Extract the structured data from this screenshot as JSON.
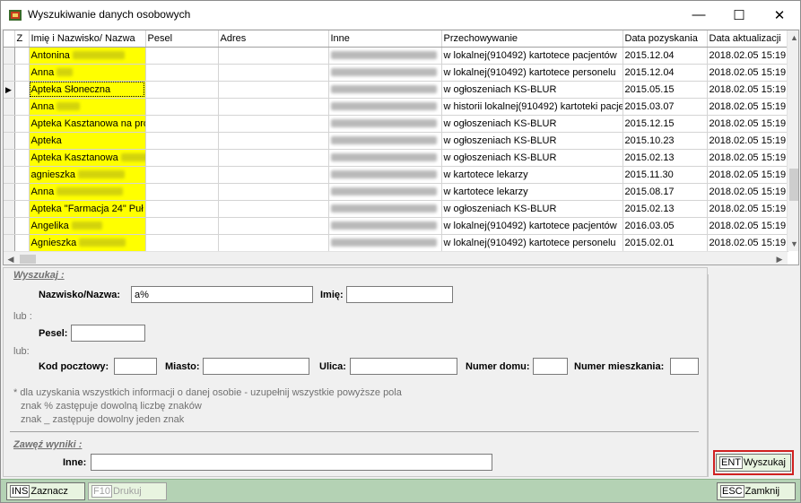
{
  "window": {
    "title": "Wyszukiwanie danych osobowych",
    "minimize_glyph": "—",
    "maximize_glyph": "☐",
    "close_glyph": "✕"
  },
  "grid": {
    "columns": [
      "Z",
      "Imię i Nazwisko/ Nazwa",
      "Pesel",
      "Adres",
      "Inne",
      "Przechowywanie",
      "Data pozyskania",
      "Data aktualizacji"
    ],
    "current_row_index": 2,
    "rows": [
      {
        "name": "Antonina",
        "przech": "w lokalnej(910492) kartotece pacjentów",
        "data_poz": "2015.12.04",
        "data_akt": "2018.02.05 15:19"
      },
      {
        "name": "Anna",
        "przech": "w lokalnej(910492) kartotece personelu",
        "data_poz": "2015.12.04",
        "data_akt": "2018.02.05 15:19"
      },
      {
        "name": "Apteka Słoneczna",
        "przech": "w ogłoszeniach KS-BLUR",
        "data_poz": "2015.05.15",
        "data_akt": "2018.02.05 15:19"
      },
      {
        "name": "Anna",
        "przech": "w historii lokalnej(910492) kartoteki pacjer",
        "data_poz": "2015.03.07",
        "data_akt": "2018.02.05 15:19"
      },
      {
        "name": "Apteka Kasztanowa na pro",
        "przech": "w ogłoszeniach KS-BLUR",
        "data_poz": "2015.12.15",
        "data_akt": "2018.02.05 15:19"
      },
      {
        "name": "Apteka",
        "przech": "w ogłoszeniach KS-BLUR",
        "data_poz": "2015.10.23",
        "data_akt": "2018.02.05 15:19"
      },
      {
        "name": "Apteka Kasztanowa",
        "przech": "w ogłoszeniach KS-BLUR",
        "data_poz": "2015.02.13",
        "data_akt": "2018.02.05 15:19"
      },
      {
        "name": "agnieszka",
        "przech": "w kartotece lekarzy",
        "data_poz": "2015.11.30",
        "data_akt": "2018.02.05 15:19"
      },
      {
        "name": "Anna",
        "przech": "w kartotece lekarzy",
        "data_poz": "2015.08.17",
        "data_akt": "2018.02.05 15:19"
      },
      {
        "name": "Apteka \"Farmacja 24\" Puł",
        "przech": "w ogłoszeniach KS-BLUR",
        "data_poz": "2015.02.13",
        "data_akt": "2018.02.05 15:19"
      },
      {
        "name": "Angelika",
        "przech": "w lokalnej(910492) kartotece pacjentów",
        "data_poz": "2016.03.05",
        "data_akt": "2018.02.05 15:19"
      },
      {
        "name": "Agnieszka",
        "przech": "w lokalnej(910492) kartotece personelu",
        "data_poz": "2015.02.01",
        "data_akt": "2018.02.05 15:19"
      }
    ]
  },
  "search": {
    "heading": "Wyszukaj :",
    "nazwisko_label": "Nazwisko/Nazwa:",
    "nazwisko_value": "a%",
    "imie_label": "Imię:",
    "imie_value": "",
    "lub1": "lub :",
    "pesel_label": "Pesel:",
    "pesel_value": "",
    "lub2": "lub:",
    "kod_label": "Kod pocztowy:",
    "miasto_label": "Miasto:",
    "ulica_label": "Ulica:",
    "dom_label": "Numer domu:",
    "mieszkanie_label": "Numer mieszkania:",
    "note1": "* dla uzyskania wszystkich informacji o danej osobie - uzupełnij wszystkie powyższe pola",
    "note2": "znak % zastępuje dowolną liczbę znaków",
    "note3": "znak _ zastępuje dowolny jeden znak",
    "narrow_heading": "Zawęź wyniki :",
    "inne_label": "Inne:",
    "inne_value": ""
  },
  "buttons": {
    "search_key": "ENT",
    "search_label": "Wyszukaj",
    "mark_key": "INS",
    "mark_label": "Zaznacz",
    "print_key": "F10",
    "print_label": "Drukuj",
    "close_key": "ESC",
    "close_label": "Zamknij"
  },
  "colors": {
    "name_highlight": "#ffff00",
    "status_bar": "#b4d2b4",
    "focus_outline": "#d02020"
  }
}
